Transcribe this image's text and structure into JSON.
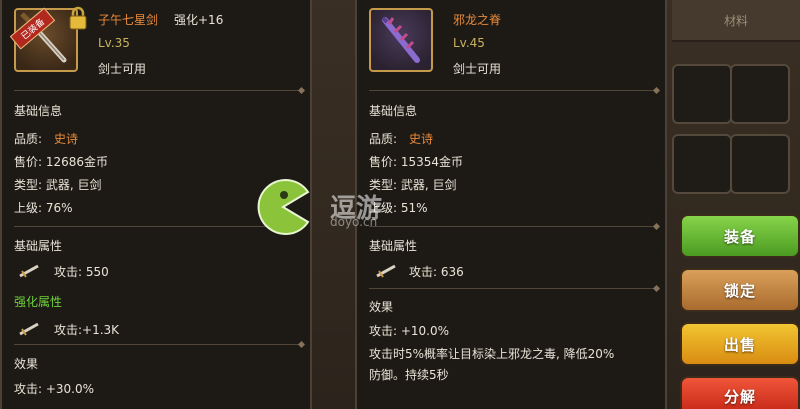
{
  "left_item": {
    "name": "子午七星剑",
    "enhance": "强化+16",
    "level": "Lv.35",
    "usable": "剑士可用",
    "equipped_tag": "已装备",
    "section_basic": "基础信息",
    "quality_label": "品质:",
    "quality_value": "史诗",
    "price": "售价: 12686金币",
    "type": "类型: 武器, 巨剑",
    "upgrade": "上级: 76%",
    "section_attr": "基础属性",
    "attack": "攻击: 550",
    "section_enh": "强化属性",
    "enh_attack": "攻击:+1.3K",
    "section_effect": "效果",
    "effect": "攻击: +30.0%"
  },
  "right_item": {
    "name": "邪龙之脊",
    "level": "Lv.45",
    "usable": "剑士可用",
    "section_basic": "基础信息",
    "quality_label": "品质:",
    "quality_value": "史诗",
    "price": "售价: 15354金币",
    "type": "类型: 武器, 巨剑",
    "upgrade": "上级: 51%",
    "section_attr": "基础属性",
    "attack": "攻击: 636",
    "section_effect": "效果",
    "effect_1": "攻击: +10.0%",
    "effect_2": "攻击时5%概率让目标染上邪龙之毒, 降低20%",
    "effect_3": "防御。持续5秒"
  },
  "tab_material": "材料",
  "buttons": {
    "equip": "装备",
    "lock": "锁定",
    "sell": "出售",
    "decompose": "分解"
  },
  "watermark": {
    "text": "逗游",
    "sub": "doyo.cn"
  },
  "colors": {
    "quality_epic": "#e78a3c",
    "enhance_green": "#6fd13b",
    "level_gold": "#c9b35e"
  }
}
